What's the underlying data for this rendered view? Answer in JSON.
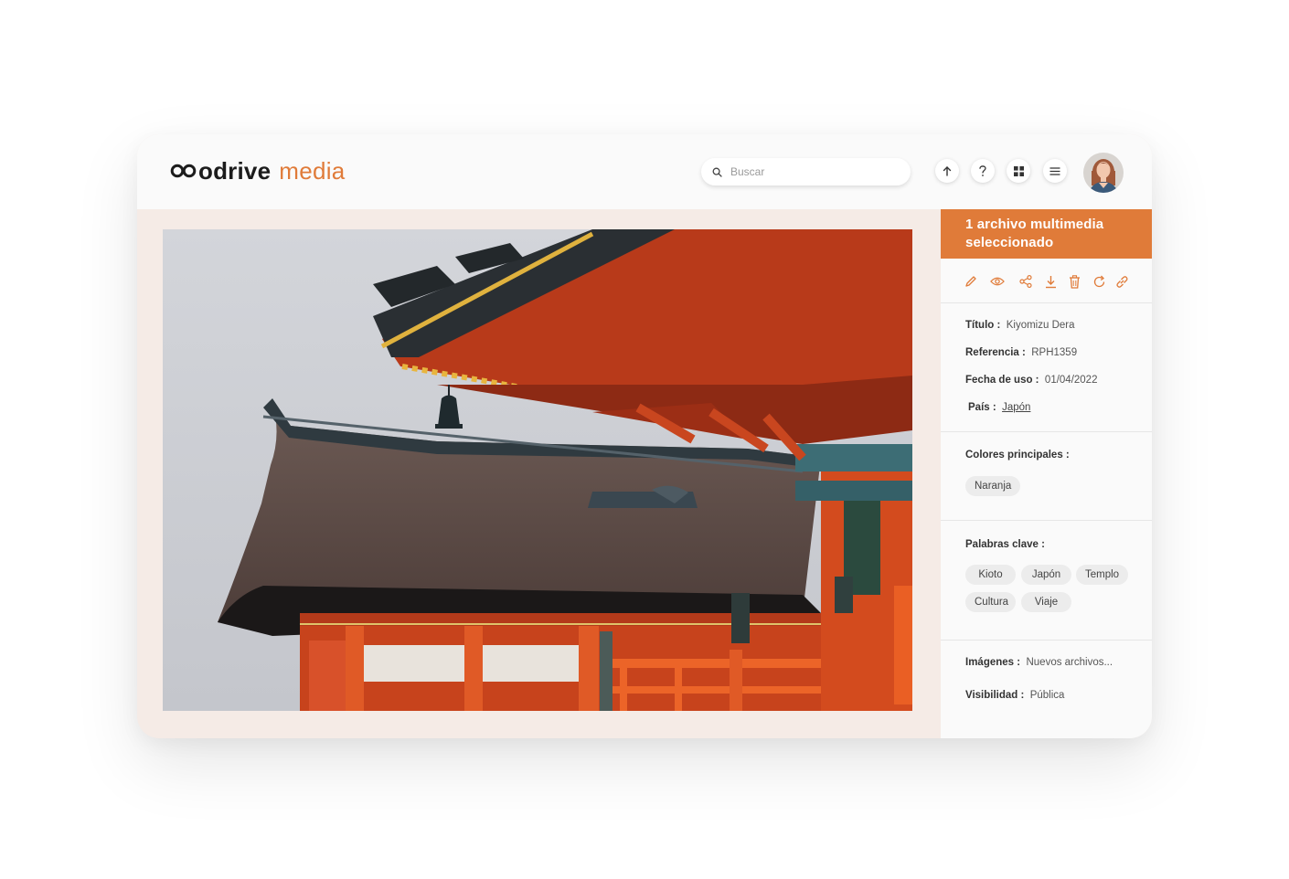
{
  "brand": {
    "name_part1": "odrive",
    "name_part2": "media"
  },
  "search": {
    "placeholder": "Buscar"
  },
  "header_buttons": [
    "upload-icon",
    "help-icon",
    "grid-icon",
    "menu-icon"
  ],
  "user": {
    "avatar": "user-avatar"
  },
  "preview": {
    "image": "kiyomizu-dera-temple-photo"
  },
  "panel": {
    "selection_title": "1 archivo multimedia seleccionado",
    "actions": [
      "edit-icon",
      "view-icon",
      "share-icon",
      "download-icon",
      "delete-icon",
      "refresh-icon",
      "link-icon"
    ],
    "fields": [
      {
        "key": "Título :",
        "value": "Kiyomizu Dera"
      },
      {
        "key": "Referencia :",
        "value": "RPH1359"
      },
      {
        "key": "Fecha de uso :",
        "value": "01/04/2022"
      },
      {
        "key": "País :",
        "value": "Japón"
      }
    ],
    "colors_title": "Colores principales :",
    "colors": [
      "Naranja"
    ],
    "keywords_title": "Palabras clave :",
    "keywords": [
      "Kioto",
      "Japón",
      "Templo",
      "Cultura",
      "Viaje"
    ],
    "images_key": "Imágenes :",
    "images_value": "Nuevos archivos...",
    "visibility_key": "Visibilidad :",
    "visibility_value": "Pública"
  },
  "colors": {
    "accent": "#e07b39",
    "background": "#f5ebe6",
    "panel": "#fafafa"
  }
}
